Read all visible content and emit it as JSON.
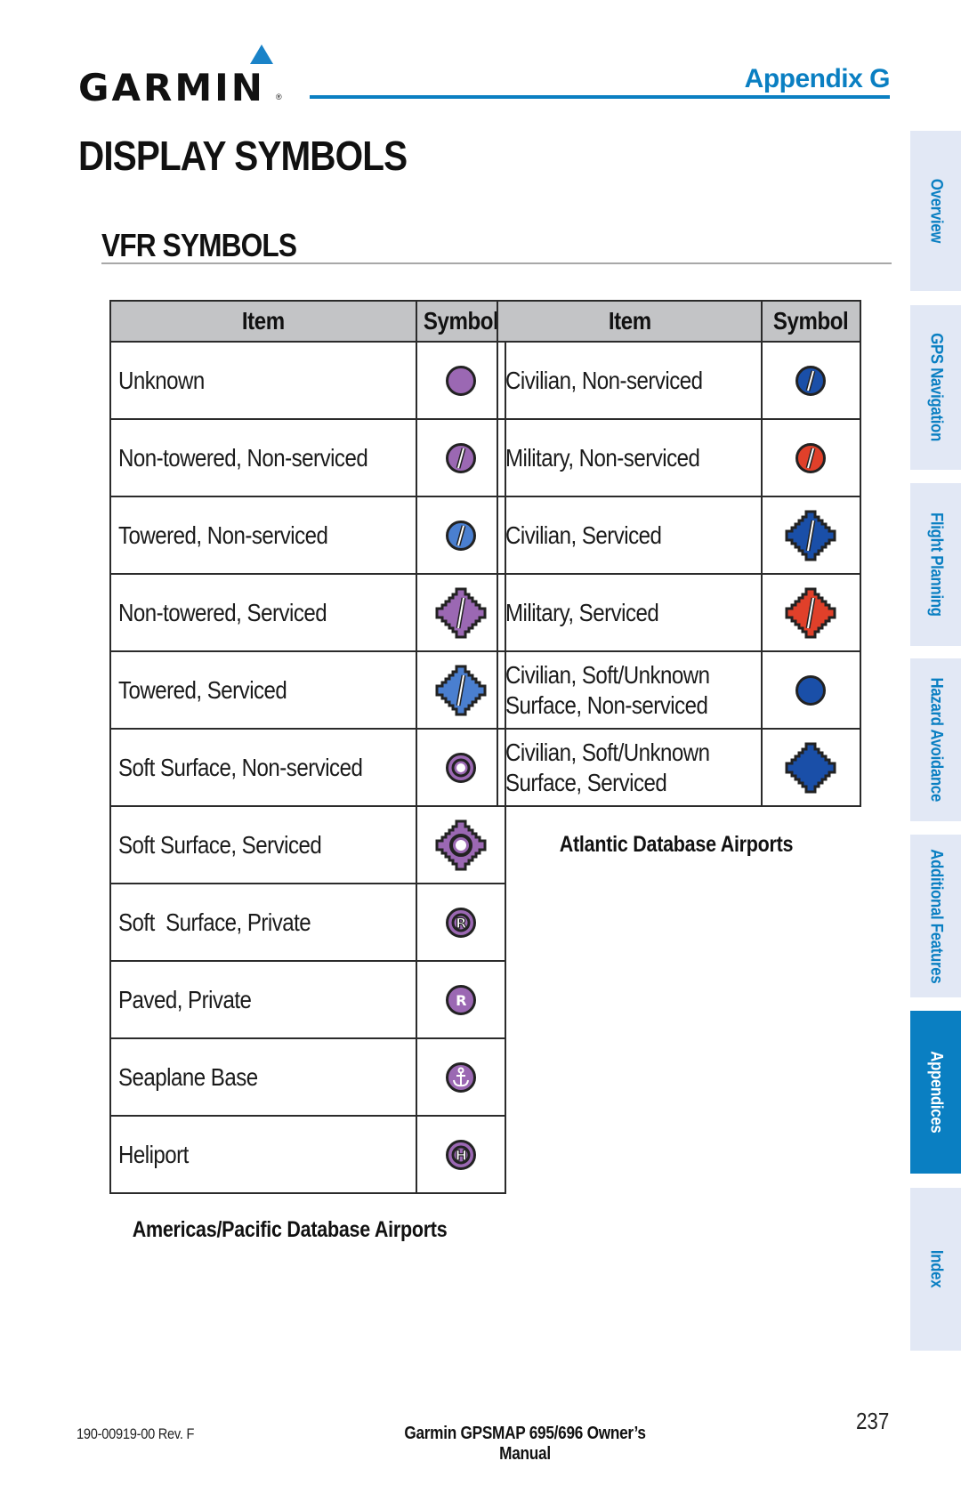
{
  "header": {
    "logo_text": "GARMIN",
    "logo_registered": "®",
    "appendix_label": "Appendix G",
    "accent_color": "#0a7fc2"
  },
  "page_title": "DISPLAY SYMBOLS",
  "section_title": "VFR SYMBOLS",
  "tables": {
    "americas": {
      "headers": [
        "Item",
        "Symbol"
      ],
      "rows": [
        {
          "item": "Unknown",
          "icon": "airport-unknown-icon",
          "shape": "circle",
          "color": "#9b68b3",
          "mark": "none"
        },
        {
          "item": "Non-towered, Non-serviced",
          "icon": "airport-nontowered-nonserviced-icon",
          "shape": "circle",
          "color": "#9b68b3",
          "mark": "runway"
        },
        {
          "item": "Towered, Non-serviced",
          "icon": "airport-towered-nonserviced-icon",
          "shape": "circle",
          "color": "#4a7fd0",
          "mark": "runway"
        },
        {
          "item": "Non-towered, Serviced",
          "icon": "airport-nontowered-serviced-icon",
          "shape": "serviced",
          "color": "#9b68b3",
          "mark": "runway"
        },
        {
          "item": "Towered, Serviced",
          "icon": "airport-towered-serviced-icon",
          "shape": "serviced",
          "color": "#4a7fd0",
          "mark": "runway"
        },
        {
          "item": "Soft Surface, Non-serviced",
          "icon": "airport-soft-nonserviced-icon",
          "shape": "ring",
          "color": "#9b68b3",
          "mark": "none"
        },
        {
          "item": "Soft Surface, Serviced",
          "icon": "airport-soft-serviced-icon",
          "shape": "serviced-ring",
          "color": "#9b68b3",
          "mark": "none"
        },
        {
          "item": "Soft  Surface, Private",
          "icon": "airport-soft-private-icon",
          "shape": "ring",
          "color": "#9b68b3",
          "mark": "R"
        },
        {
          "item": "Paved, Private",
          "icon": "airport-paved-private-icon",
          "shape": "circle",
          "color": "#9b68b3",
          "mark": "R"
        },
        {
          "item": "Seaplane Base",
          "icon": "seaplane-base-anchor-icon",
          "shape": "circle",
          "color": "#9b68b3",
          "mark": "anchor"
        },
        {
          "item": "Heliport",
          "icon": "heliport-icon",
          "shape": "ring",
          "color": "#9b68b3",
          "mark": "H"
        }
      ],
      "caption": "Americas/Pacific Database Airports"
    },
    "atlantic": {
      "headers": [
        "Item",
        "Symbol"
      ],
      "rows": [
        {
          "item": "Civilian, Non-serviced",
          "icon": "airport-civilian-nonserviced-icon",
          "shape": "circle",
          "color": "#1a4fa8",
          "mark": "runway"
        },
        {
          "item": "Military, Non-serviced",
          "icon": "airport-military-nonserviced-icon",
          "shape": "circle",
          "color": "#e0402a",
          "mark": "runway"
        },
        {
          "item": "Civilian, Serviced",
          "icon": "airport-civilian-serviced-icon",
          "shape": "serviced",
          "color": "#1a4fa8",
          "mark": "runway"
        },
        {
          "item": "Military, Serviced",
          "icon": "airport-military-serviced-icon",
          "shape": "serviced",
          "color": "#e0402a",
          "mark": "runway"
        },
        {
          "item": "Civilian, Soft/Unknown\nSurface, Non-serviced",
          "icon": "airport-civilian-soft-nonserviced-icon",
          "shape": "circle",
          "color": "#1a4fa8",
          "mark": "none"
        },
        {
          "item": "Civilian, Soft/Unknown\nSurface, Serviced",
          "icon": "airport-civilian-soft-serviced-icon",
          "shape": "serviced",
          "color": "#1a4fa8",
          "mark": "none"
        }
      ],
      "caption": "Atlantic Database Airports"
    }
  },
  "side_tabs": [
    {
      "label": "Overview",
      "active": false
    },
    {
      "label": "GPS Navigation",
      "active": false
    },
    {
      "label": "Flight Planning",
      "active": false
    },
    {
      "label": "Hazard Avoidance",
      "active": false
    },
    {
      "label": "Additional Features",
      "active": false
    },
    {
      "label": "Appendices",
      "active": true
    },
    {
      "label": "Index",
      "active": false
    }
  ],
  "footer": {
    "doc_number": "190-00919-00 Rev. F",
    "manual_title": "Garmin GPSMAP 695/696 Owner’s Manual",
    "page_number": "237"
  }
}
